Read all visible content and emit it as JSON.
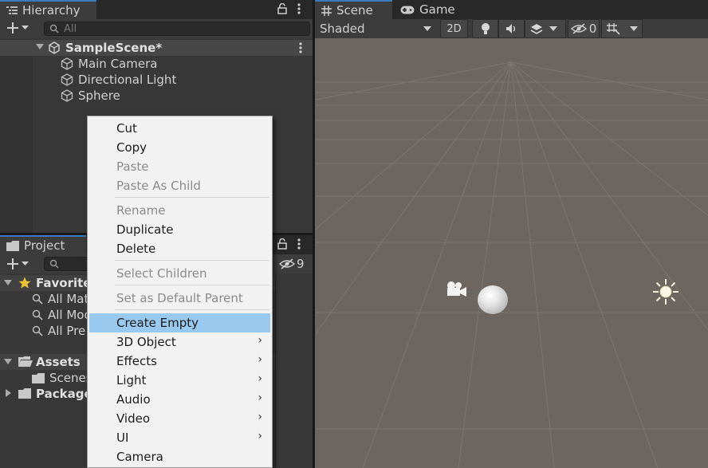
{
  "hierarchy": {
    "tab_title": "Hierarchy",
    "search_placeholder": "All",
    "scene_name": "SampleScene*",
    "items": [
      "Main Camera",
      "Directional Light",
      "Sphere"
    ]
  },
  "project": {
    "tab_title": "Project",
    "hidden_count": "9",
    "favorites_label": "Favorites",
    "favorites": [
      "All Mat",
      "All Mod",
      "All Pre"
    ],
    "assets_label": "Assets",
    "assets_children": [
      "Scenes"
    ],
    "packages_label": "Package"
  },
  "scene": {
    "tab_scene": "Scene",
    "tab_game": "Game",
    "shading_mode": "Shaded",
    "btn_2d": "2D",
    "hidden_count": "0"
  },
  "context_menu": {
    "cut": "Cut",
    "copy": "Copy",
    "paste": "Paste",
    "paste_as_child": "Paste As Child",
    "rename": "Rename",
    "duplicate": "Duplicate",
    "delete": "Delete",
    "select_children": "Select Children",
    "set_default_parent": "Set as Default Parent",
    "create_empty": "Create Empty",
    "object_3d": "3D Object",
    "effects": "Effects",
    "light": "Light",
    "audio": "Audio",
    "video": "Video",
    "ui": "UI",
    "camera": "Camera",
    "submenu_arrow": "›"
  },
  "colors": {
    "highlight": "#99c9ef",
    "accent": "#3a79bb",
    "scene_bg": "#6c6560"
  }
}
